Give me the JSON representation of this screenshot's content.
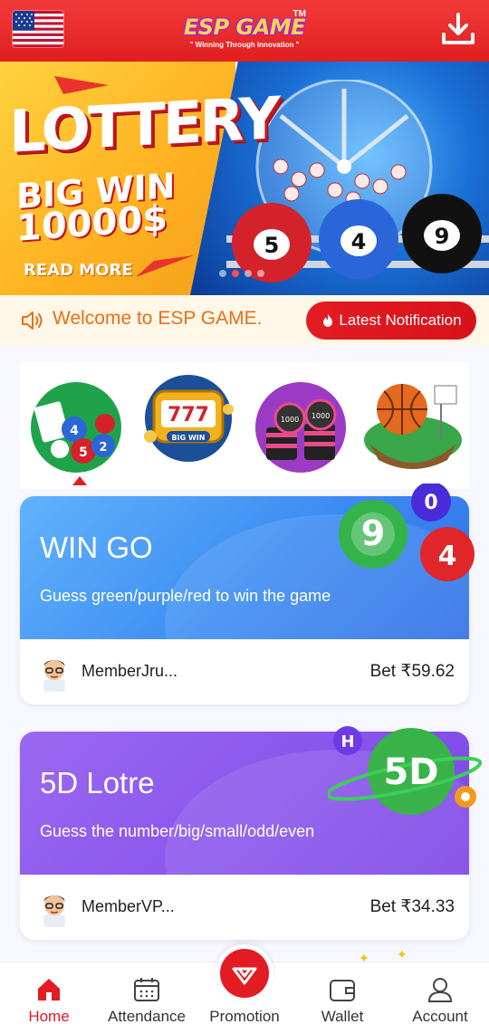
{
  "header": {
    "logo_title": "ESP GAME",
    "logo_tm": "TM",
    "logo_tagline": "\" Winning Through Innovation \"",
    "flag_icon": "us-flag-icon",
    "download_icon": "download-icon"
  },
  "banner": {
    "title": "LOTTERY",
    "subtitle": "BIG WIN",
    "amount": "10000$",
    "read_more": "READ MORE",
    "slide_count": 4,
    "active_slide": 2
  },
  "notice": {
    "welcome": "Welcome to ESP GAME.",
    "button_label": "Latest Notification"
  },
  "categories": [
    {
      "name": "lottery",
      "icon": "lottery-balls-icon"
    },
    {
      "name": "slots",
      "icon": "slot-machine-icon"
    },
    {
      "name": "casino",
      "icon": "casino-chips-icon"
    },
    {
      "name": "sports",
      "icon": "basketball-icon"
    }
  ],
  "games": [
    {
      "title": "WIN GO",
      "description": "Guess green/purple/red to win the game",
      "member": "MemberJru...",
      "bet": "Bet  ₹59.62",
      "balls": [
        "9",
        "0",
        "4"
      ]
    },
    {
      "title": "5D Lotre",
      "description": "Guess the number/big/small/odd/even",
      "member": "MemberVP...",
      "bet": "Bet  ₹34.33",
      "badges": [
        "H",
        "5D"
      ]
    }
  ],
  "bottom_nav": [
    {
      "label": "Home",
      "icon": "home-icon",
      "active": true
    },
    {
      "label": "Attendance",
      "icon": "calendar-icon",
      "active": false
    },
    {
      "label": "Promotion",
      "icon": "diamond-icon",
      "active": false
    },
    {
      "label": "Wallet",
      "icon": "wallet-icon",
      "active": false
    },
    {
      "label": "Account",
      "icon": "user-icon",
      "active": false
    }
  ],
  "colors": {
    "brand_red": "#e31b23",
    "notice_text": "#e87017",
    "card1": "#4a9cf6",
    "card2": "#8a55ec"
  }
}
